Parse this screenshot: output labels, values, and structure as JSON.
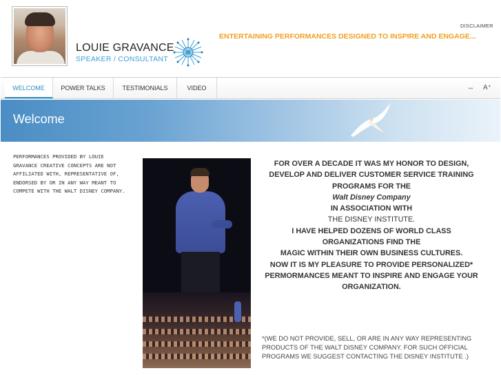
{
  "header": {
    "name": "LOUIE GRAVANCE",
    "subtitle": "SPEAKER / CONSULTANT",
    "tagline": "ENTERTAINING PERFORMANCES DESIGNED TO INSPIRE AND ENGAGE...",
    "disclaimer_link": "DISCLAIMER"
  },
  "nav": {
    "items": [
      {
        "label": "WELCOME",
        "active": true
      },
      {
        "label": "POWER TALKS",
        "active": false
      },
      {
        "label": "TESTIMONIALS",
        "active": false
      },
      {
        "label": "VIDEO",
        "active": false
      }
    ],
    "tools": {
      "expand": "↔",
      "font_size": "A⁺"
    }
  },
  "banner": {
    "title": "Welcome"
  },
  "side_note": "PERFORMANCES PROVIDED BY LOUIE GRAVANCE CREATIVE CONCEPTS ARE NOT AFFILIATED WITH, REPRESENTATIVE OF, ENDORSED BY OR IN ANY WAY MEANT TO COMPETE WITH THE WALT DISNEY COMPANY.",
  "main": {
    "lines": [
      {
        "text": "FOR OVER A DECADE IT WAS MY HONOR TO DESIGN,",
        "style": "b"
      },
      {
        "text": "DEVELOP AND DELIVER CUSTOMER SERVICE TRAINING",
        "style": "b"
      },
      {
        "text": "PROGRAMS FOR THE",
        "style": "b"
      },
      {
        "text": "Walt Disney Company",
        "style": "i"
      },
      {
        "text": "IN ASSOCIATION WITH",
        "style": "b"
      },
      {
        "text": "THE DISNEY INSTITUTE.",
        "style": "n"
      },
      {
        "text": "I HAVE HELPED DOZENS OF WORLD CLASS",
        "style": "b"
      },
      {
        "text": "ORGANIZATIONS FIND THE",
        "style": "b"
      },
      {
        "text": "MAGIC WITHIN THEIR OWN BUSINESS CULTURES.",
        "style": "b"
      },
      {
        "text": "NOW IT IS MY PLEASURE TO PROVIDE PERSONALIZED*",
        "style": "b"
      },
      {
        "text": "PERMORMANCES MEANT TO INSPIRE AND ENGAGE YOUR",
        "style": "b"
      },
      {
        "text": "ORGANIZATION.",
        "style": "b"
      }
    ],
    "footnote": "*(WE DO NOT PROVIDE, SELL, OR ARE IN ANY WAY REPRESENTING PRODUCTS OF THE WALT DISNEY COMPANY. FOR SUCH OFFICIAL PROGRAMS WE SUGGEST CONTACTING THE DISNEY INSTITUTE .)"
  },
  "colors": {
    "accent_blue": "#2b8cc4",
    "tagline_orange": "#f0a020",
    "subtitle_blue": "#3a9fd5"
  },
  "icons": [
    "star-logo-icon",
    "seagull-icon",
    "expand-icon",
    "font-size-icon"
  ]
}
